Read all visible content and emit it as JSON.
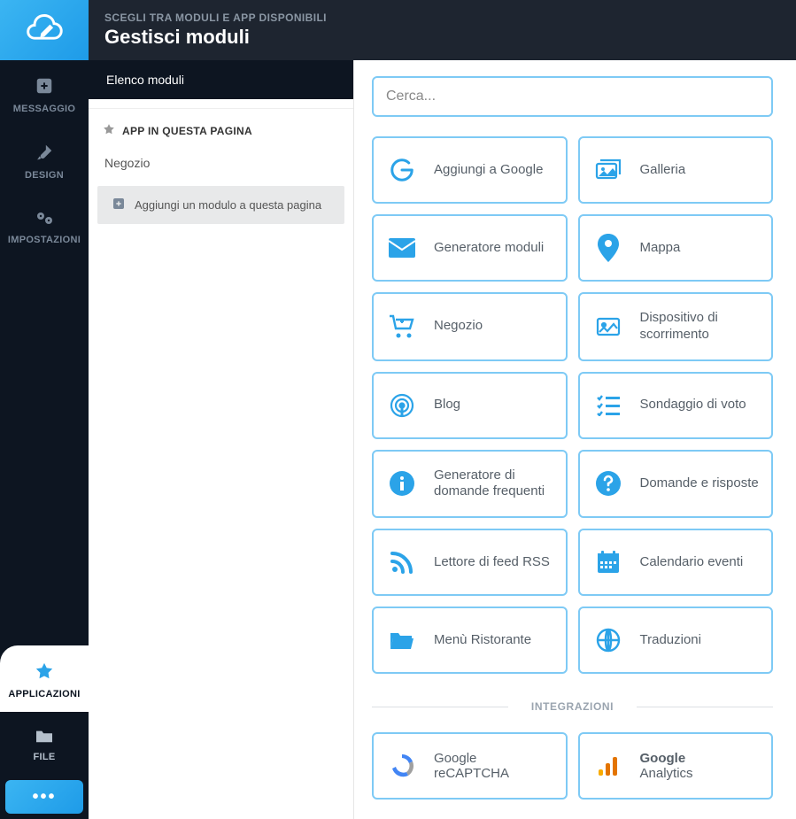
{
  "header": {
    "subtitle": "SCEGLI TRA MODULI E APP DISPONIBILI",
    "title": "Gestisci moduli"
  },
  "sidebar": {
    "items": [
      {
        "id": "messaggio",
        "label": "MESSAGGIO",
        "icon": "plus-square"
      },
      {
        "id": "design",
        "label": "DESIGN",
        "icon": "brush"
      },
      {
        "id": "impostazioni",
        "label": "IMPOSTAZIONI",
        "icon": "gears"
      },
      {
        "id": "applicazioni",
        "label": "APPLICAZIONI",
        "icon": "star"
      },
      {
        "id": "file",
        "label": "FILE",
        "icon": "folder"
      }
    ],
    "more": "•••"
  },
  "panel": {
    "tab": "Elenco moduli",
    "section_header": "APP IN QUESTA PAGINA",
    "apps": [
      "Negozio"
    ],
    "add_module": "Aggiungi un modulo a questa pagina"
  },
  "search": {
    "placeholder": "Cerca..."
  },
  "modules": [
    {
      "label": "Aggiungi a Google",
      "icon": "google"
    },
    {
      "label": "Galleria",
      "icon": "gallery"
    },
    {
      "label": "Generatore moduli",
      "icon": "envelope"
    },
    {
      "label": "Mappa",
      "icon": "map-pin"
    },
    {
      "label": "Negozio",
      "icon": "cart"
    },
    {
      "label": "Dispositivo di scorrimento",
      "icon": "slider-img"
    },
    {
      "label": "Blog",
      "icon": "podcast"
    },
    {
      "label": "Sondaggio di voto",
      "icon": "checklist"
    },
    {
      "label": "Generatore di domande frequenti",
      "icon": "info"
    },
    {
      "label": "Domande e risposte",
      "icon": "question"
    },
    {
      "label": "Lettore di feed RSS",
      "icon": "rss"
    },
    {
      "label": "Calendario eventi",
      "icon": "calendar"
    },
    {
      "label": "Menù Ristorante",
      "icon": "folder-open"
    },
    {
      "label": "Traduzioni",
      "icon": "globe"
    }
  ],
  "integrations_label": "INTEGRAZIONI",
  "integrations": [
    {
      "label1": "Google",
      "label2": "reCAPTCHA",
      "icon": "recaptcha"
    },
    {
      "label1": "Google",
      "label2": "Analytics",
      "icon": "analytics"
    }
  ]
}
